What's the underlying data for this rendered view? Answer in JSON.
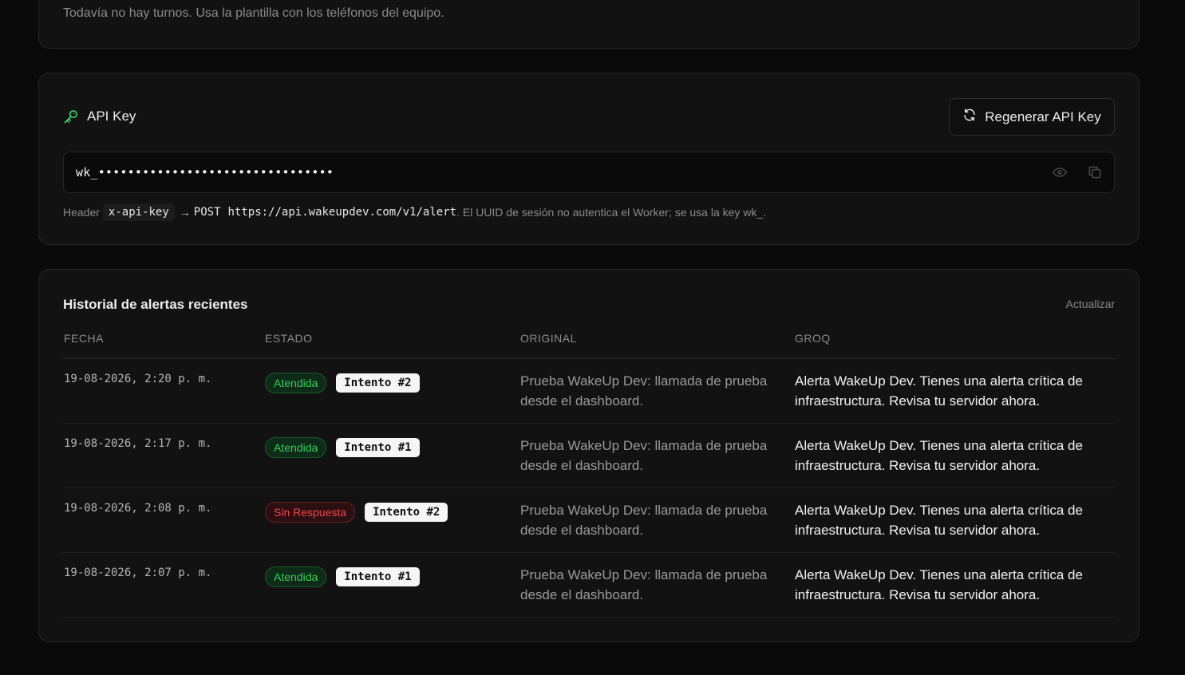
{
  "shifts": {
    "empty_text": "Todavía no hay turnos. Usa la plantilla con los teléfonos del equipo."
  },
  "api_key": {
    "title": "API Key",
    "regenerate_label": "Regenerar API Key",
    "masked_value": "wk_••••••••••••••••••••••••••••••••",
    "help_header_word": "Header",
    "help_header_name": "x-api-key",
    "help_arrow": "→",
    "help_method": "POST",
    "help_url": "https://api.wakeupdev.com/v1/alert",
    "help_note": ". El UUID de sesión no autentica el Worker; se usa la key wk_.",
    "accent_color": "#3fd06a"
  },
  "history": {
    "title": "Historial de alertas recientes",
    "refresh_label": "Actualizar",
    "columns": {
      "date": "FECHA",
      "status": "ESTADO",
      "original": "ORIGINAL",
      "groq": "GROQ"
    },
    "rows": [
      {
        "date": "19-08-2026, 2:20 p. m.",
        "status": "Atendida",
        "status_type": "ok",
        "attempt": "Intento #2",
        "original": "Prueba WakeUp Dev: llamada de prueba desde el dashboard.",
        "groq": "Alerta WakeUp Dev. Tienes una alerta crítica de infraestructura. Revisa tu servidor ahora."
      },
      {
        "date": "19-08-2026, 2:17 p. m.",
        "status": "Atendida",
        "status_type": "ok",
        "attempt": "Intento #1",
        "original": "Prueba WakeUp Dev: llamada de prueba desde el dashboard.",
        "groq": "Alerta WakeUp Dev. Tienes una alerta crítica de infraestructura. Revisa tu servidor ahora."
      },
      {
        "date": "19-08-2026, 2:08 p. m.",
        "status": "Sin Respuesta",
        "status_type": "fail",
        "attempt": "Intento #2",
        "original": "Prueba WakeUp Dev: llamada de prueba desde el dashboard.",
        "groq": "Alerta WakeUp Dev. Tienes una alerta crítica de infraestructura. Revisa tu servidor ahora."
      },
      {
        "date": "19-08-2026, 2:07 p. m.",
        "status": "Atendida",
        "status_type": "ok",
        "attempt": "Intento #1",
        "original": "Prueba WakeUp Dev: llamada de prueba desde el dashboard.",
        "groq": "Alerta WakeUp Dev. Tienes una alerta crítica de infraestructura. Revisa tu servidor ahora."
      }
    ]
  }
}
